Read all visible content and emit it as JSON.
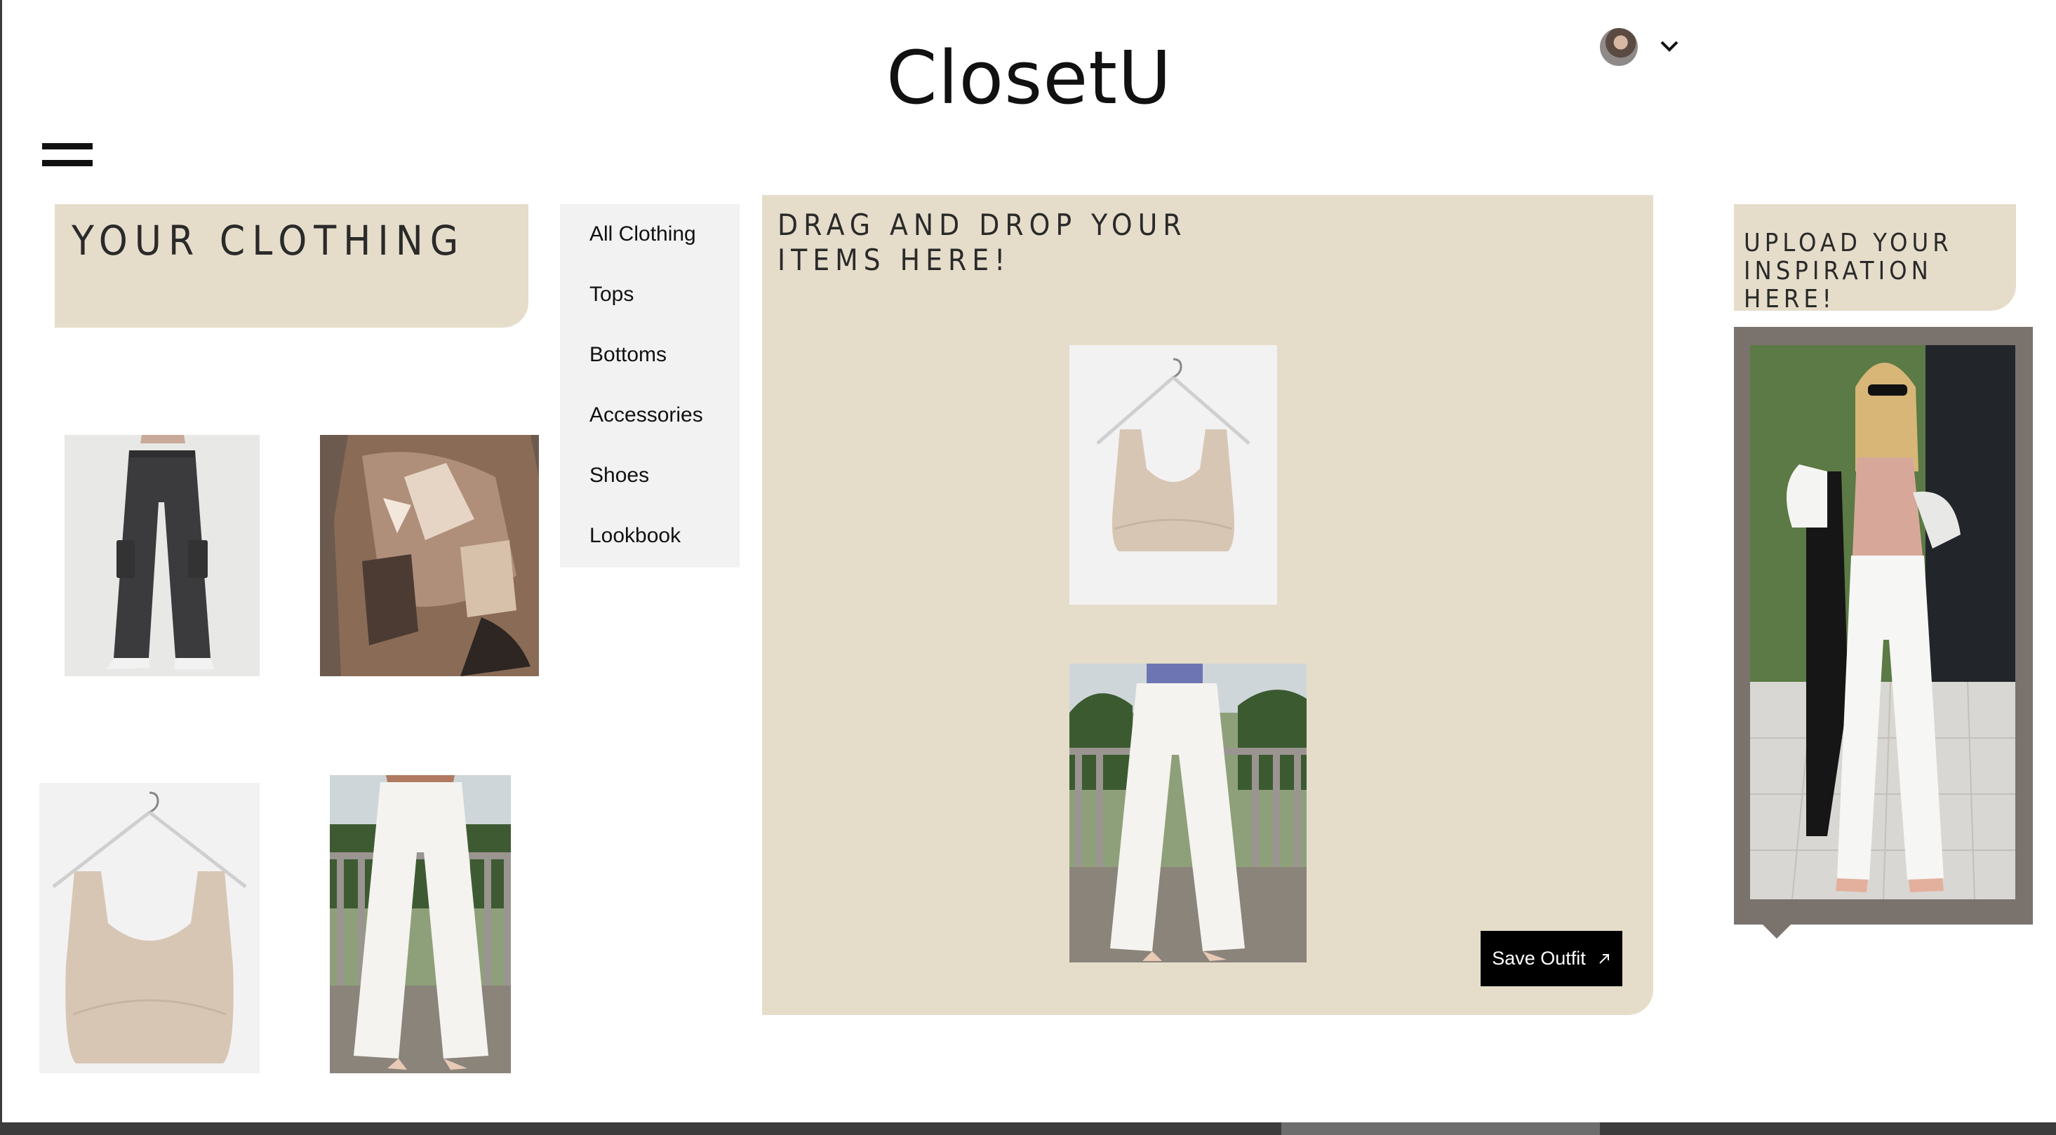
{
  "header": {
    "logo": "ClosetU",
    "menu_icon": "hamburger-icon",
    "account_icon": "avatar",
    "dropdown_icon": "chevron-down-icon"
  },
  "wardrobe": {
    "title": "YOUR CLOTHING",
    "items": [
      {
        "name": "grey-cargo-jeans",
        "kind": "bottom"
      },
      {
        "name": "printed-mesh-top",
        "kind": "top"
      },
      {
        "name": "beige-crop-tank",
        "kind": "top"
      },
      {
        "name": "white-wide-leg-jeans",
        "kind": "bottom"
      }
    ]
  },
  "categories": {
    "items": [
      {
        "label": "All Clothing"
      },
      {
        "label": "Tops"
      },
      {
        "label": "Bottoms"
      },
      {
        "label": "Accessories"
      },
      {
        "label": "Shoes"
      },
      {
        "label": "Lookbook"
      }
    ]
  },
  "board": {
    "title": "DRAG AND DROP YOUR ITEMS HERE!",
    "placed_items": [
      "beige-crop-tank",
      "white-wide-leg-jeans"
    ],
    "save_label": "Save Outfit",
    "save_icon": "arrow-up-right-icon"
  },
  "inspiration": {
    "title": "UPLOAD YOUR INSPIRATION HERE!",
    "frame_color": "#7a726d"
  },
  "colors": {
    "accent": "#e5ddca",
    "menu_bg": "#f2f2f2",
    "button_bg": "#000000"
  }
}
